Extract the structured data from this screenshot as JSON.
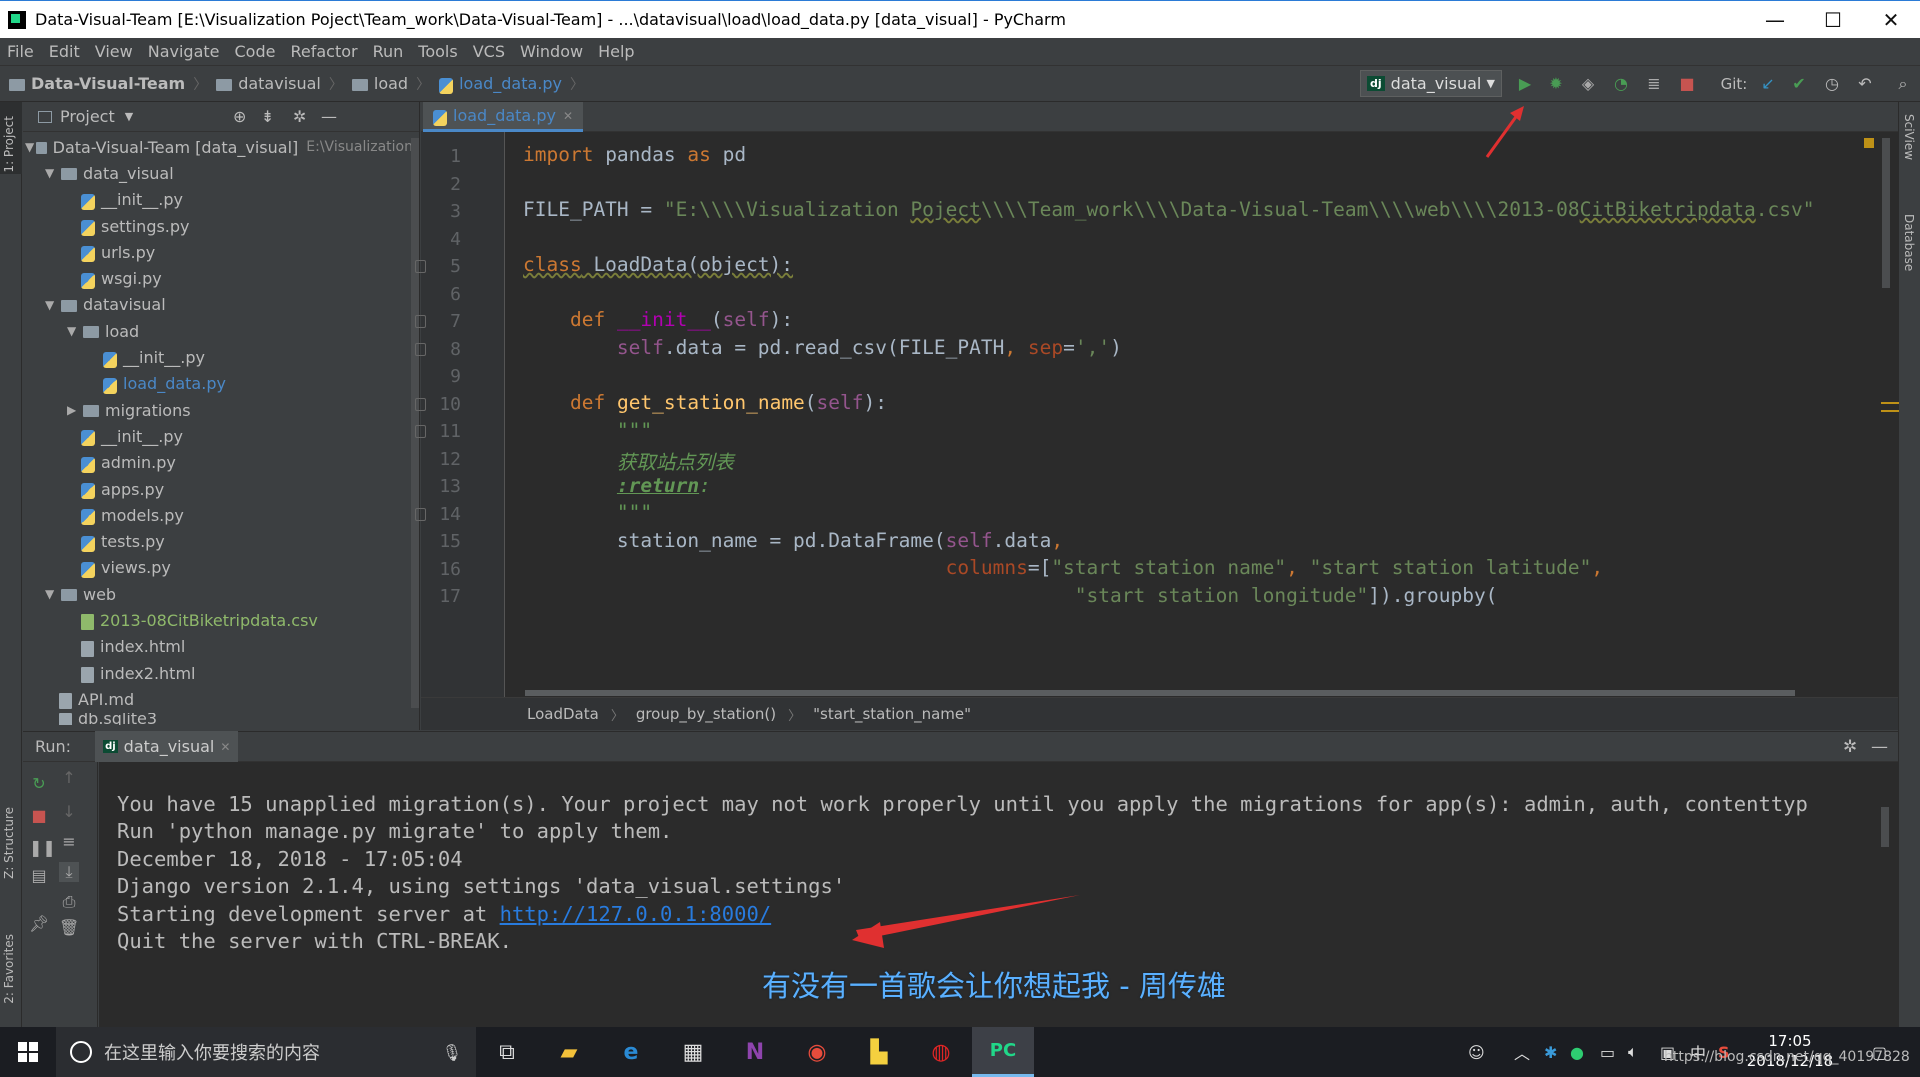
{
  "window": {
    "title": "Data-Visual-Team [E:\\Visualization Poject\\Team_work\\Data-Visual-Team] - ...\\datavisual\\load\\load_data.py [data_visual] - PyCharm",
    "minimize": "—",
    "maximize": "☐",
    "close": "✕"
  },
  "menu": [
    "File",
    "Edit",
    "View",
    "Navigate",
    "Code",
    "Refactor",
    "Run",
    "Tools",
    "VCS",
    "Window",
    "Help"
  ],
  "breadcrumb": [
    "Data-Visual-Team",
    "datavisual",
    "load",
    "load_data.py"
  ],
  "toolbar": {
    "run_config": "data_visual",
    "run_config_badge": "dj",
    "git_label": "Git:"
  },
  "side_left": {
    "project": "1: Project",
    "structure": "Z: Structure",
    "favorites": "2: Favorites"
  },
  "side_right": {
    "sciview": "SciView",
    "database": "Database"
  },
  "project_panel": {
    "title": "Project",
    "tree": [
      {
        "label": "Data-Visual-Team [data_visual]",
        "path": "E:\\Visualization",
        "kind": "root"
      },
      {
        "label": "data_visual",
        "kind": "folder"
      },
      {
        "label": "__init__.py",
        "kind": "py"
      },
      {
        "label": "settings.py",
        "kind": "py"
      },
      {
        "label": "urls.py",
        "kind": "py"
      },
      {
        "label": "wsgi.py",
        "kind": "py"
      },
      {
        "label": "datavisual",
        "kind": "folder"
      },
      {
        "label": "load",
        "kind": "folder"
      },
      {
        "label": "__init__.py",
        "kind": "py"
      },
      {
        "label": "load_data.py",
        "kind": "py-active"
      },
      {
        "label": "migrations",
        "kind": "folder"
      },
      {
        "label": "__init__.py",
        "kind": "py"
      },
      {
        "label": "admin.py",
        "kind": "py"
      },
      {
        "label": "apps.py",
        "kind": "py"
      },
      {
        "label": "models.py",
        "kind": "py"
      },
      {
        "label": "tests.py",
        "kind": "py"
      },
      {
        "label": "views.py",
        "kind": "py"
      },
      {
        "label": "web",
        "kind": "folder"
      },
      {
        "label": "2013-08CitBiketripdata.csv",
        "kind": "csv"
      },
      {
        "label": "index.html",
        "kind": "file"
      },
      {
        "label": "index2.html",
        "kind": "file"
      },
      {
        "label": "API.md",
        "kind": "file"
      },
      {
        "label": "db.sqlite3",
        "kind": "file"
      }
    ]
  },
  "editor": {
    "tab": "load_data.py",
    "line_numbers": [
      "1",
      "2",
      "3",
      "4",
      "5",
      "6",
      "7",
      "8",
      "9",
      "10",
      "11",
      "12",
      "13",
      "14",
      "15",
      "16",
      "17"
    ],
    "breadcrumb": [
      "LoadData",
      "group_by_station()",
      "\"start_station_name\""
    ]
  },
  "run_panel": {
    "label": "Run:",
    "tab": "data_visual",
    "output": [
      "You have 15 unapplied migration(s). Your project may not work properly until you apply the migrations for app(s): admin, auth, contenttyp",
      "Run 'python manage.py migrate' to apply them.",
      "December 18, 2018 - 17:05:04",
      "Django version 2.1.4, using settings 'data_visual.settings'",
      "Starting development server at ",
      "Quit the server with CTRL-BREAK."
    ],
    "server_url": "http://127.0.0.1:8000/"
  },
  "caption": "有没有一首歌会让你想起我 - 周传雄",
  "taskbar": {
    "search_placeholder": "在这里输入你要搜索的内容",
    "time": "17:05",
    "date": "2018/12/18",
    "watermark": "https://blog.csdn.net/qq_40197828",
    "ime": "中"
  }
}
